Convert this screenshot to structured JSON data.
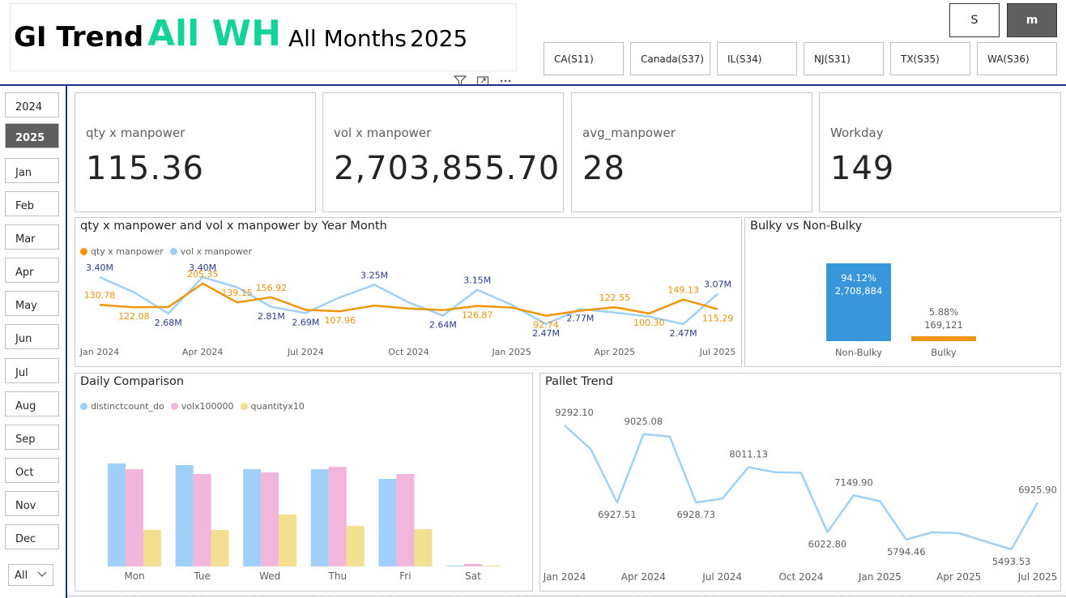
{
  "header": {
    "title": "GI Trend",
    "warehouse": "All WH",
    "months": "All Months",
    "year": "2025"
  },
  "unit_toggle": {
    "s_label": "S",
    "m_label": "m",
    "selected": "m"
  },
  "warehouses": [
    "CA(S11)",
    "Canada(S37)",
    "IL(S34)",
    "NJ(S31)",
    "TX(S35)",
    "WA(S36)"
  ],
  "slicer": {
    "items": [
      "2024",
      "2025",
      "Jan",
      "Feb",
      "Mar",
      "Apr",
      "May",
      "Jun",
      "Jul",
      "Aug",
      "Sep",
      "Oct",
      "Nov",
      "Dec"
    ],
    "selected": "2025",
    "dropdown_value": "All"
  },
  "cards": [
    {
      "label": "qty x manpower",
      "value": "115.36"
    },
    {
      "label": "vol x manpower",
      "value": "2,703,855.70"
    },
    {
      "label": "avg_manpower",
      "value": "28"
    },
    {
      "label": "Workday",
      "value": "149"
    }
  ],
  "colors": {
    "qty": "#f0960e",
    "vol": "#9fd0f7",
    "bulky_bar": "#3897da",
    "distinct": "#a0cff7",
    "volx": "#f2b6dc",
    "quantity": "#f2e090",
    "pallet": "#9fd0f7",
    "selected_bg": "#5f5f5f",
    "title_green": "#15d19a",
    "divider": "#1f2d8a"
  },
  "chart_data": [
    {
      "type": "line",
      "title": "qty x manpower and vol x manpower by Year Month",
      "x_ticks": [
        "Jan 2024",
        "Apr 2024",
        "Jul 2024",
        "Oct 2024",
        "Jan 2025",
        "Apr 2025",
        "Jul 2025"
      ],
      "x": [
        "2024-01",
        "2024-02",
        "2024-03",
        "2024-04",
        "2024-05",
        "2024-06",
        "2024-07",
        "2024-08",
        "2024-09",
        "2024-10",
        "2024-11",
        "2024-12",
        "2025-01",
        "2025-02",
        "2025-03",
        "2025-04",
        "2025-05",
        "2025-06",
        "2025-07"
      ],
      "series": [
        {
          "name": "qty x manpower",
          "values": [
            130.78,
            122.08,
            123,
            205.35,
            139.15,
            156.92,
            113,
            107.96,
            128,
            118,
            112,
            126.87,
            121,
            92.74,
            110,
            122.55,
            100.3,
            149.13,
            115.29
          ],
          "labels": [
            "130.78",
            "122.08",
            "",
            "205.35",
            "139.15",
            "156.92",
            "",
            "107.96",
            "",
            "",
            "",
            "126.87",
            "",
            "92.74",
            "",
            "122.55",
            "100.30",
            "149.13",
            "115.29"
          ]
        },
        {
          "name": "vol x manpower",
          "values": [
            3.4,
            3.1,
            2.68,
            3.4,
            3.2,
            2.81,
            2.69,
            3.0,
            3.25,
            2.9,
            2.64,
            3.15,
            2.85,
            2.47,
            2.77,
            2.7,
            2.62,
            2.47,
            3.07
          ],
          "labels": [
            "3.40M",
            "",
            "2.68M",
            "3.40M",
            "",
            "2.81M",
            "2.69M",
            "",
            "3.25M",
            "",
            "2.64M",
            "3.15M",
            "",
            "2.47M",
            "2.77M",
            "",
            "",
            "2.47M",
            "3.07M"
          ]
        }
      ]
    },
    {
      "type": "bar",
      "title": "Bulky vs Non-Bulky",
      "categories": [
        "Non-Bulky",
        "Bulky"
      ],
      "values": [
        2708884,
        169121
      ],
      "value_labels": [
        "2,708,884",
        "169,121"
      ],
      "percent_labels": [
        "94.12%",
        "5.88%"
      ]
    },
    {
      "type": "bar",
      "title": "Daily Comparison",
      "categories": [
        "Mon",
        "Tue",
        "Wed",
        "Thu",
        "Fri",
        "Sat"
      ],
      "series": [
        {
          "name": "distinctcount_do",
          "values": [
            127,
            125,
            120,
            120,
            108,
            1
          ]
        },
        {
          "name": "volx100000",
          "values": [
            120,
            114,
            116,
            123,
            114,
            3
          ]
        },
        {
          "name": "quantityx10",
          "values": [
            45,
            45,
            64,
            50,
            46,
            1
          ]
        }
      ]
    },
    {
      "type": "line",
      "title": "Pallet Trend",
      "x_ticks": [
        "Jan 2024",
        "Apr 2024",
        "Jul 2024",
        "Oct 2024",
        "Jan 2025",
        "Apr 2025",
        "Jul 2025"
      ],
      "x": [
        "2024-01",
        "2024-02",
        "2024-03",
        "2024-04",
        "2024-05",
        "2024-06",
        "2024-07",
        "2024-08",
        "2024-09",
        "2024-10",
        "2024-11",
        "2024-12",
        "2025-01",
        "2025-02",
        "2025-03",
        "2025-04",
        "2025-05",
        "2025-06",
        "2025-07"
      ],
      "series": [
        {
          "values": [
            9292.1,
            8560,
            6927.51,
            9025.08,
            8950,
            6928.73,
            7050,
            8011.13,
            7860,
            7840,
            6022.8,
            7149.9,
            6970,
            5794.46,
            6020,
            5990,
            5740,
            5493.53,
            6925.9
          ],
          "labels": [
            "9292.10",
            "",
            "6927.51",
            "9025.08",
            "",
            "6928.73",
            "",
            "8011.13",
            "",
            "",
            "6022.80",
            "7149.90",
            "",
            "5794.46",
            "",
            "",
            "",
            "5493.53",
            "6925.90"
          ]
        }
      ]
    }
  ]
}
